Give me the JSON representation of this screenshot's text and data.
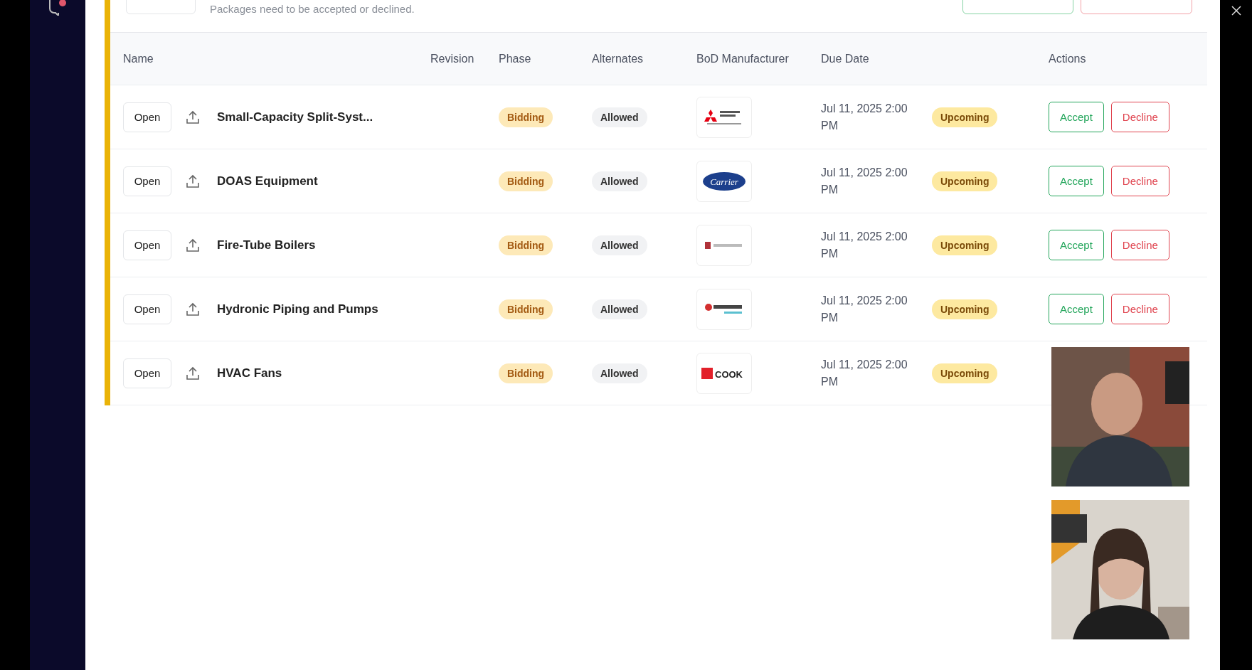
{
  "header": {
    "subtitle": "Packages need to be accepted or declined."
  },
  "table": {
    "columns": [
      "Name",
      "Revision",
      "Phase",
      "Alternates",
      "BoD Manufacturer",
      "Due Date",
      "Actions"
    ],
    "rows": [
      {
        "open": "Open",
        "name": "Small-Capacity Split-Syst...",
        "phase": "Bidding",
        "alternates": "Allowed",
        "logo": {
          "kind": "mitsubishi"
        },
        "due": "Jul 11, 2025 2:00 PM",
        "status": "Upcoming",
        "actions": [
          "Accept",
          "Decline"
        ]
      },
      {
        "open": "Open",
        "name": "DOAS Equipment",
        "phase": "Bidding",
        "alternates": "Allowed",
        "logo": {
          "kind": "carrier",
          "text": "Carrier"
        },
        "due": "Jul 11, 2025 2:00 PM",
        "status": "Upcoming",
        "actions": [
          "Accept",
          "Decline"
        ]
      },
      {
        "open": "Open",
        "name": "Fire-Tube Boilers",
        "phase": "Bidding",
        "alternates": "Allowed",
        "logo": {
          "kind": "lochinvar"
        },
        "due": "Jul 11, 2025 2:00 PM",
        "status": "Upcoming",
        "actions": [
          "Accept",
          "Decline"
        ]
      },
      {
        "open": "Open",
        "name": "Hydronic Piping and Pumps",
        "phase": "Bidding",
        "alternates": "Allowed",
        "logo": {
          "kind": "bellgossett"
        },
        "due": "Jul 11, 2025 2:00 PM",
        "status": "Upcoming",
        "actions": [
          "Accept",
          "Decline"
        ]
      },
      {
        "open": "Open",
        "name": "HVAC Fans",
        "phase": "Bidding",
        "alternates": "Allowed",
        "logo": {
          "kind": "cook",
          "text": "COOK"
        },
        "due": "Jul 11, 2025 2:00 PM",
        "status": "Upcoming"
      }
    ]
  }
}
